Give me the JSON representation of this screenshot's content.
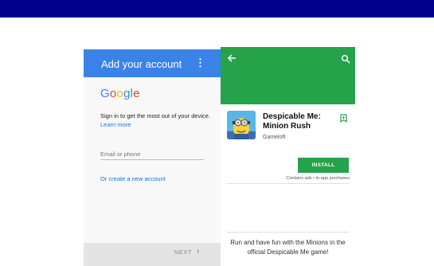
{
  "colors": {
    "top_bar": "#00008b",
    "google_blue_header": "#3b82e8",
    "play_green": "#26a24b",
    "link_blue": "#1a73e8"
  },
  "google_signin": {
    "title": "Add your account",
    "menu_icon": "more-vert-icon",
    "logo_letters": [
      "G",
      "o",
      "o",
      "g",
      "l",
      "e"
    ],
    "logo_colors": [
      "#4285f4",
      "#ea4335",
      "#fbbc05",
      "#4285f4",
      "#34a853",
      "#ea4335"
    ],
    "signin_text": "Sign in to get the most out of your device.",
    "learn_more": "Learn more",
    "email_placeholder": "Email or phone",
    "create_account": "Or create a new account",
    "next_label": "NEXT",
    "next_icon": "chevron-right-icon"
  },
  "play_store": {
    "back_icon": "arrow-back-icon",
    "search_icon": "search-icon",
    "app_icon": "minion-app-icon",
    "app_title": "Despicable Me: Minion Rush",
    "developer": "Gameloft",
    "wishlist_icon": "bookmark-icon",
    "install_label": "INSTALL",
    "contains_ads": "Contains ads • In-app purchases",
    "description": "Run and have fun with the Minions in the official Despicable Me game!"
  }
}
